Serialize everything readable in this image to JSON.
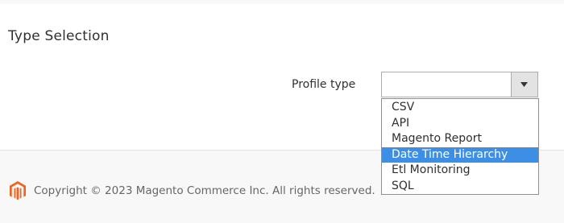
{
  "section": {
    "title": "Type Selection"
  },
  "profile_type": {
    "label": "Profile type",
    "value": "",
    "options": [
      {
        "label": "CSV",
        "selected": false
      },
      {
        "label": "API",
        "selected": false
      },
      {
        "label": "Magento Report",
        "selected": false
      },
      {
        "label": "Date Time Hierarchy",
        "selected": true
      },
      {
        "label": "Etl Monitoring",
        "selected": false
      },
      {
        "label": "SQL",
        "selected": false
      }
    ]
  },
  "footer": {
    "logo_icon": "magento-logo-icon",
    "copyright": "Copyright © 2023 Magento Commerce Inc. All rights reserved."
  },
  "colors": {
    "highlight": "#3d8ee5",
    "logo": "#f26322",
    "footer_bg": "#f8f8f8",
    "select_button_bg": "#e3e3e3"
  }
}
